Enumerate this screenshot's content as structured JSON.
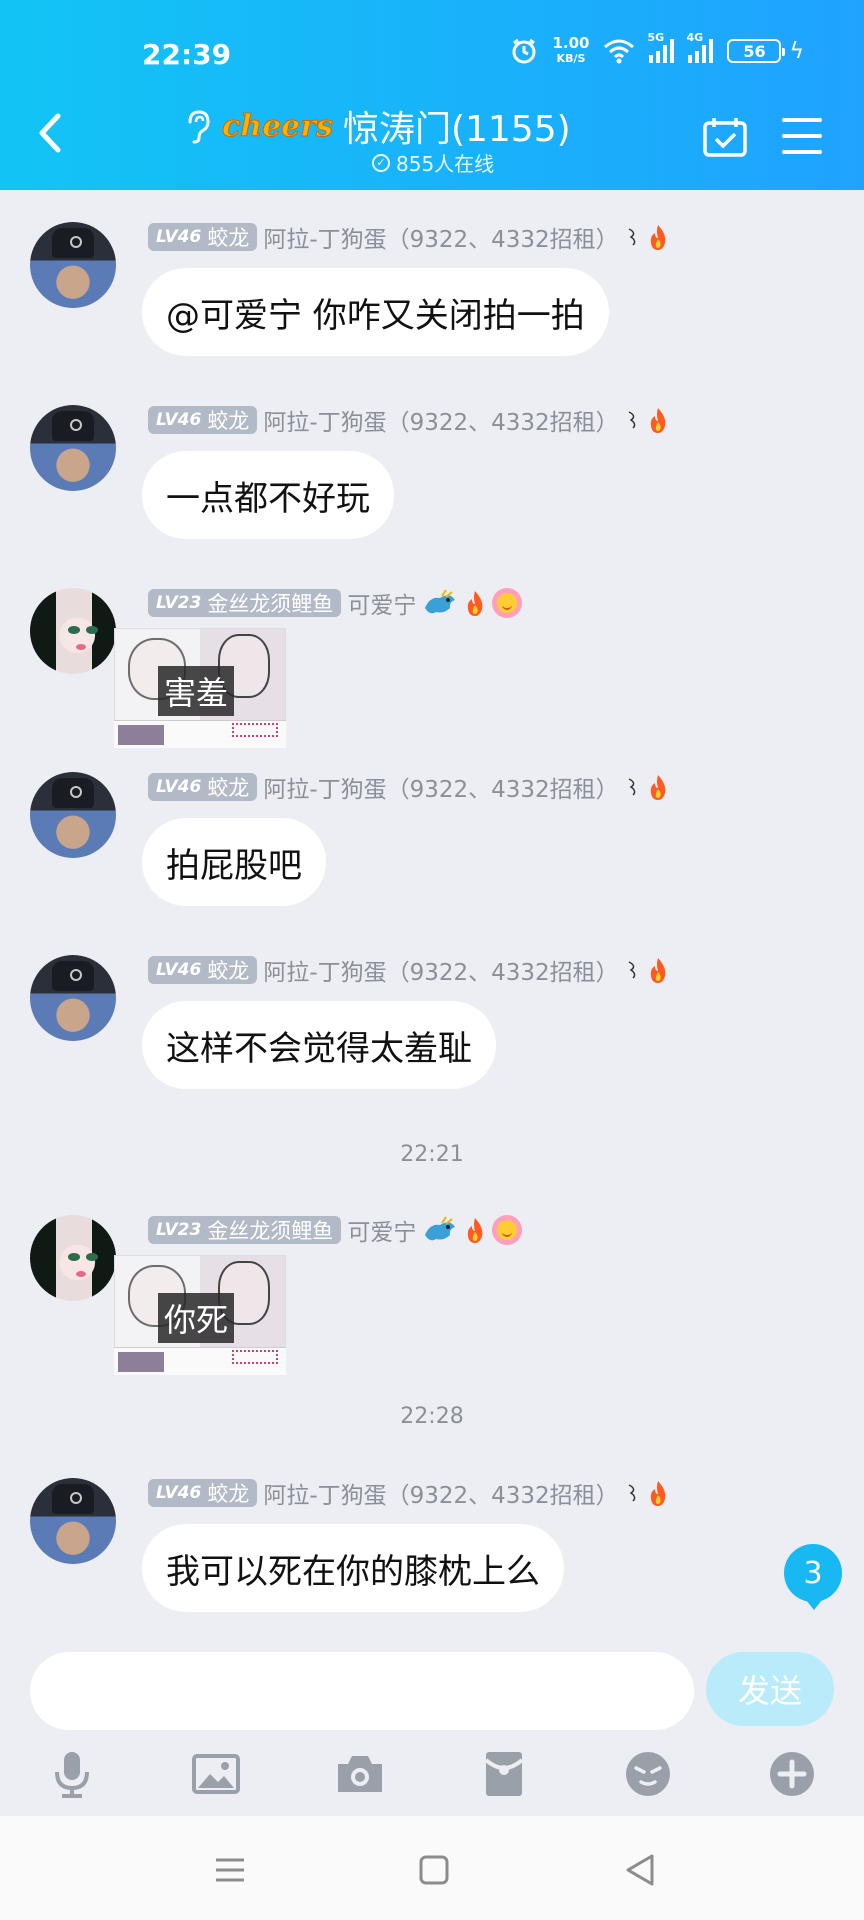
{
  "status_bar": {
    "time": "22:39",
    "net_speed": "1.00",
    "net_unit": "KB/S",
    "sig1_tag": "5G",
    "sig2_tag": "4G",
    "battery": "56",
    "icons": [
      "alarm-icon",
      "wifi-icon",
      "signal-icon",
      "battery-icon",
      "charging-icon"
    ]
  },
  "header": {
    "logo_text": "cheers",
    "title": "惊涛门(1155)",
    "online": "855人在线",
    "icons": [
      "back-icon",
      "ear-icon",
      "calendar-check-icon",
      "menu-icon"
    ]
  },
  "messages": [
    {
      "type": "text",
      "user": "阿拉-丁狗蛋（9322、4332招租）",
      "level": "LV46",
      "title": "蛟龙",
      "text": "@可爱宁 你咋又关闭拍一拍",
      "avatar": "man"
    },
    {
      "type": "text",
      "user": "阿拉-丁狗蛋（9322、4332招租）",
      "level": "LV46",
      "title": "蛟龙",
      "text": "一点都不好玩",
      "avatar": "man"
    },
    {
      "type": "sticker",
      "user": "可爱宁",
      "level": "LV23",
      "title": "金丝龙须鲤鱼",
      "sticker_text": "害羞",
      "avatar": "girl"
    },
    {
      "type": "text",
      "user": "阿拉-丁狗蛋（9322、4332招租）",
      "level": "LV46",
      "title": "蛟龙",
      "text": "拍屁股吧",
      "avatar": "man"
    },
    {
      "type": "text",
      "user": "阿拉-丁狗蛋（9322、4332招租）",
      "level": "LV46",
      "title": "蛟龙",
      "text": "这样不会觉得太羞耻",
      "avatar": "man"
    },
    {
      "type": "sticker",
      "user": "可爱宁",
      "level": "LV23",
      "title": "金丝龙须鲤鱼",
      "sticker_text": "你死",
      "avatar": "girl"
    },
    {
      "type": "text",
      "user": "阿拉-丁狗蛋（9322、4332招租）",
      "level": "LV46",
      "title": "蛟龙",
      "text": "我可以死在你的膝枕上么",
      "avatar": "man"
    }
  ],
  "timestamps": [
    "22:21",
    "22:28"
  ],
  "unread_count": "3",
  "composer": {
    "placeholder": "",
    "send_label": "发送",
    "tools": [
      "mic-icon",
      "image-icon",
      "camera-icon",
      "red-packet-icon",
      "emoji-icon",
      "plus-icon"
    ]
  },
  "colors": {
    "header": "#1fa3ff",
    "background": "#edeef3",
    "bubble": "#ffffff",
    "badge": "#b3bac7",
    "send": "#b9ebfb",
    "unread": "#18b8f2"
  }
}
